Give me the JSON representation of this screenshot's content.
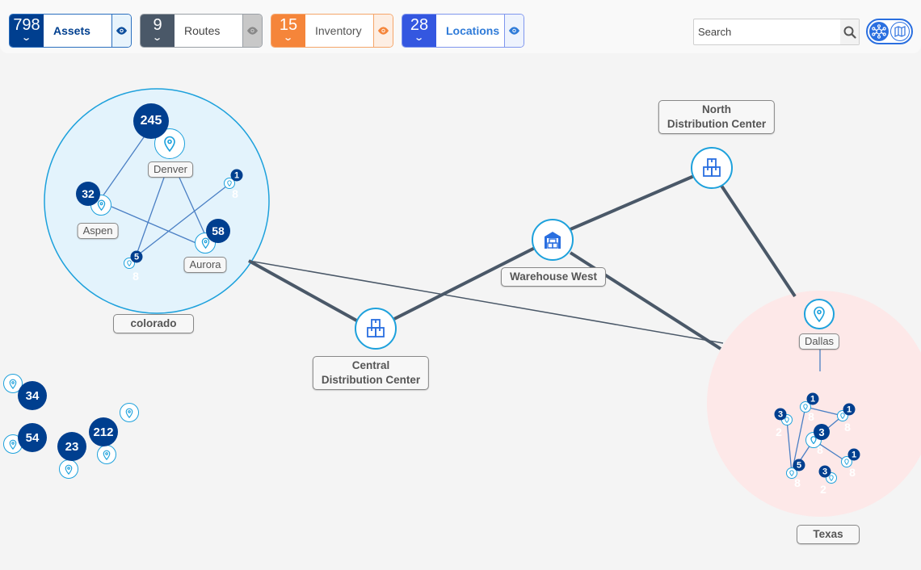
{
  "toolbar": {
    "filters": [
      {
        "count": "798",
        "label": "Assets",
        "color": "#003f8f",
        "border": "#2a6fbf",
        "label_color": "#003f8f",
        "eye_bg": "#e8f4fc",
        "eye_color": "#0d4f9e"
      },
      {
        "count": "9",
        "label": "Routes",
        "color": "#4a5868",
        "border": "#9aa0a6",
        "label_color": "#444",
        "eye_bg": "#c8c8c8",
        "eye_color": "#888"
      },
      {
        "count": "15",
        "label": "Inventory",
        "color": "#f5853a",
        "border": "#f5a56a",
        "label_color": "#555",
        "eye_bg": "#fdeee3",
        "eye_color": "#f5853a"
      },
      {
        "count": "28",
        "label": "Locations",
        "color": "#3457e0",
        "border": "#7f96ee",
        "label_color": "#2f7bd8",
        "eye_bg": "#eef3fd",
        "eye_color": "#2f7bd8"
      }
    ],
    "search_placeholder": "Search",
    "view_modes": [
      "network-view",
      "map-view"
    ],
    "active_view": "network-view"
  },
  "groups": [
    {
      "name": "colorado",
      "fill": "#e3f3fc",
      "stroke": "#1da1dc"
    },
    {
      "name": "Texas",
      "fill": "#fde8e8",
      "stroke": "none"
    }
  ],
  "hubs": [
    {
      "name": "North Distribution Center",
      "lines": [
        "North",
        "Distribution Center"
      ],
      "icon": "boxes-icon"
    },
    {
      "name": "Warehouse West",
      "lines": [
        "Warehouse West"
      ],
      "icon": "warehouse-icon"
    },
    {
      "name": "Central Distribution Center",
      "lines": [
        "Central",
        "Distribution Center"
      ],
      "icon": "boxes-icon"
    }
  ],
  "locations": [
    {
      "name": "Denver",
      "count": "245"
    },
    {
      "name": "Aspen",
      "count": "32"
    },
    {
      "name": "Aurora",
      "count": "58"
    },
    {
      "name": "Dallas",
      "count": ""
    }
  ],
  "colorado_small": [
    {
      "count": "1",
      "sub": "8"
    },
    {
      "count": "5",
      "sub": "8"
    }
  ],
  "ungrouped": [
    {
      "count": "34"
    },
    {
      "count": "54"
    },
    {
      "count": "23"
    },
    {
      "count": "212"
    },
    {
      "count": ""
    }
  ],
  "texas_small": [
    {
      "count": "1",
      "sub": "8"
    },
    {
      "count": "1",
      "sub": "8"
    },
    {
      "count": "3",
      "sub": "2"
    },
    {
      "count": "3",
      "sub": "8"
    },
    {
      "count": "1",
      "sub": "8"
    },
    {
      "count": "5",
      "sub": "8"
    },
    {
      "count": "3",
      "sub": "2"
    }
  ]
}
